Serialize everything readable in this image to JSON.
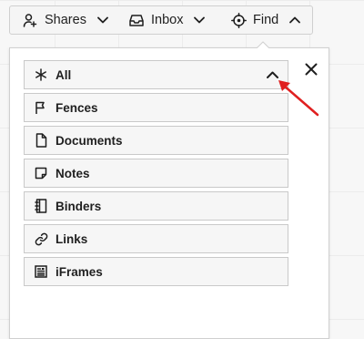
{
  "toolbar": {
    "shares": {
      "label": "Shares",
      "icon": "user-share-icon"
    },
    "inbox": {
      "label": "Inbox",
      "icon": "inbox-tray-icon"
    },
    "find": {
      "label": "Find",
      "icon": "crosshair-icon"
    }
  },
  "panel": {
    "items": [
      {
        "label": "All",
        "icon": "asterisk-icon",
        "expanded": true
      },
      {
        "label": "Fences",
        "icon": "flag-icon"
      },
      {
        "label": "Documents",
        "icon": "document-icon"
      },
      {
        "label": "Notes",
        "icon": "note-icon"
      },
      {
        "label": "Binders",
        "icon": "binder-icon"
      },
      {
        "label": "Links",
        "icon": "link-icon"
      },
      {
        "label": "iFrames",
        "icon": "iframe-icon"
      }
    ]
  },
  "colors": {
    "annotation_arrow": "#e02020",
    "border": "#c9c9c9"
  }
}
